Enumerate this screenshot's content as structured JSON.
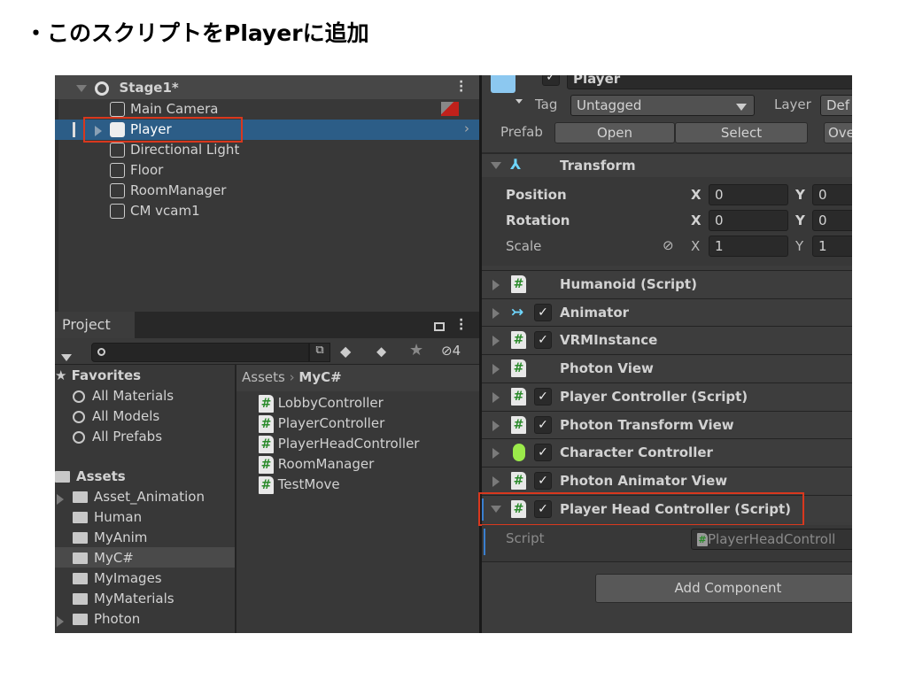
{
  "slide_title": "・このスクリプトをPlayerに追加",
  "colors": {
    "highlight_box": "#d9381e",
    "selection": "#2c5d87",
    "panel": "#383838"
  },
  "hierarchy": {
    "scene": "Stage1*",
    "items": [
      {
        "label": "Main Camera",
        "selected": false
      },
      {
        "label": "Player",
        "selected": true
      },
      {
        "label": "Directional Light",
        "selected": false
      },
      {
        "label": "Floor",
        "selected": false
      },
      {
        "label": "RoomManager",
        "selected": false
      },
      {
        "label": "CM vcam1",
        "selected": false
      }
    ]
  },
  "project": {
    "tab": "Project",
    "search_placeholder": "",
    "hidden_count": "4",
    "favorites_label": "Favorites",
    "favorites": [
      "All Materials",
      "All Models",
      "All Prefabs"
    ],
    "assets_label": "Assets",
    "folders": [
      "Asset_Animation",
      "Human",
      "MyAnim",
      "MyC#",
      "MyImages",
      "MyMaterials",
      "Photon"
    ],
    "selected_folder": "MyC#",
    "breadcrumb": [
      "Assets",
      "MyC#"
    ],
    "files": [
      "LobbyController",
      "PlayerController",
      "PlayerHeadController",
      "RoomManager",
      "TestMove"
    ]
  },
  "inspector": {
    "object_name": "Player",
    "tag_label": "Tag",
    "tag_value": "Untagged",
    "layer_label": "Layer",
    "layer_value": "Def",
    "prefab_label": "Prefab",
    "prefab_open": "Open",
    "prefab_select": "Select",
    "prefab_overrides": "Ove",
    "transform": {
      "title": "Transform",
      "rows": [
        {
          "label": "Position",
          "x": "0",
          "y": "0"
        },
        {
          "label": "Rotation",
          "x": "0",
          "y": "0"
        },
        {
          "label": "Scale",
          "x": "1",
          "y": "1"
        }
      ],
      "x_label": "X",
      "y_label": "Y"
    },
    "components": [
      {
        "label": "Humanoid (Script)",
        "icon": "script-icon",
        "checkbox": false
      },
      {
        "label": "Animator",
        "icon": "animator-icon",
        "checkbox": true
      },
      {
        "label": "VRMInstance",
        "icon": "script-icon",
        "checkbox": true
      },
      {
        "label": "Photon View",
        "icon": "script-icon",
        "checkbox": false
      },
      {
        "label": "Player Controller (Script)",
        "icon": "script-icon",
        "checkbox": true
      },
      {
        "label": "Photon Transform View",
        "icon": "script-icon",
        "checkbox": true
      },
      {
        "label": "Character Controller",
        "icon": "capsule-icon",
        "checkbox": true
      },
      {
        "label": "Photon Animator View",
        "icon": "script-icon",
        "checkbox": true
      },
      {
        "label": "Player Head Controller (Script)",
        "icon": "script-add-icon",
        "checkbox": true
      }
    ],
    "script_label": "Script",
    "script_value": "PlayerHeadControll",
    "add_component": "Add Component"
  }
}
